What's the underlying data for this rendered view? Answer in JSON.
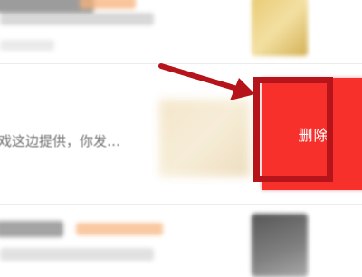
{
  "conversation_list": {
    "swiped_item": {
      "preview_text": "戏这边提供，你发…",
      "delete_label": "删除"
    }
  },
  "colors": {
    "delete_bg": "#f7302c",
    "annotation": "#b5151a",
    "tag_accent": "#f7b27a"
  }
}
